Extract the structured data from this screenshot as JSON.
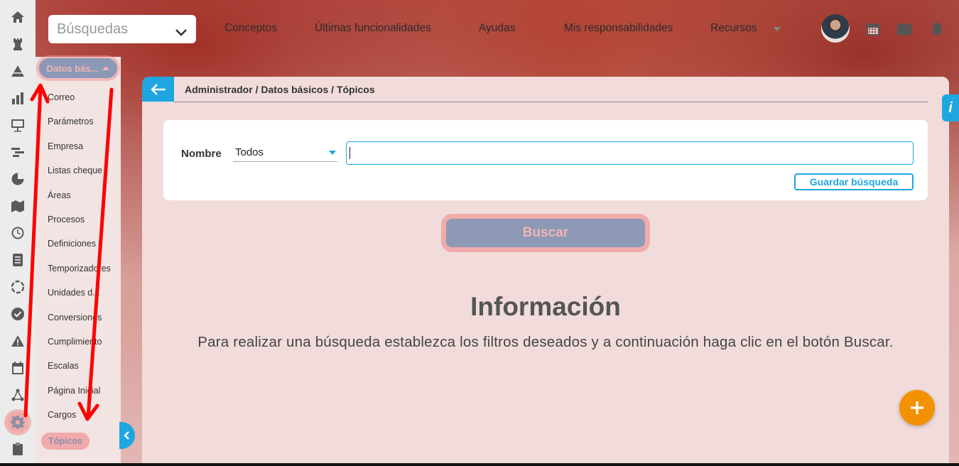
{
  "topbar": {
    "search_placeholder": "Búsquedas",
    "nav": [
      "Conceptos",
      "Últimas funcionalidades",
      "Ayudas",
      "Mis responsabilidades",
      "Recursos"
    ]
  },
  "rail": {
    "icons": [
      "home-icon",
      "chess-rook-icon",
      "pyramid-icon",
      "bar-chart-icon",
      "presentation-icon",
      "gantt-icon",
      "pie-chart-icon",
      "map-icon",
      "clock-icon",
      "document-list-icon",
      "cycle-icon",
      "check-circle-icon",
      "warning-icon",
      "calendar-icon",
      "network-icon",
      "gear-icon",
      "clipboard-icon"
    ],
    "active_icon": "gear-icon"
  },
  "submenu": {
    "header": "Datos bás...",
    "items": [
      "Correo",
      "Parámetros",
      "Empresa",
      "Listas cheque",
      "Áreas",
      "Procesos",
      "Definiciones",
      "Temporizadores",
      "Unidades d...",
      "Conversiones",
      "Cumplimiento",
      "Escalas",
      "Página Inicial",
      "Cargos"
    ],
    "active_item": "Tópicos"
  },
  "panel": {
    "breadcrumb": "Administrador / Datos básicos / Tópicos",
    "filter_label": "Nombre",
    "filter_select_value": "Todos",
    "filter_input_value": "",
    "save_search_label": "Guardar búsqueda",
    "search_button_label": "Buscar",
    "info_title": "Información",
    "info_text": "Para realizar una búsqueda establezca los filtros deseados y a continuación haga clic en el botón Buscar.",
    "info_tab_label": "i"
  },
  "colors": {
    "accent": "#1fa6e0",
    "fab": "#f39200",
    "highlight": "#f1a9a9",
    "annotation": "#ff0000"
  }
}
